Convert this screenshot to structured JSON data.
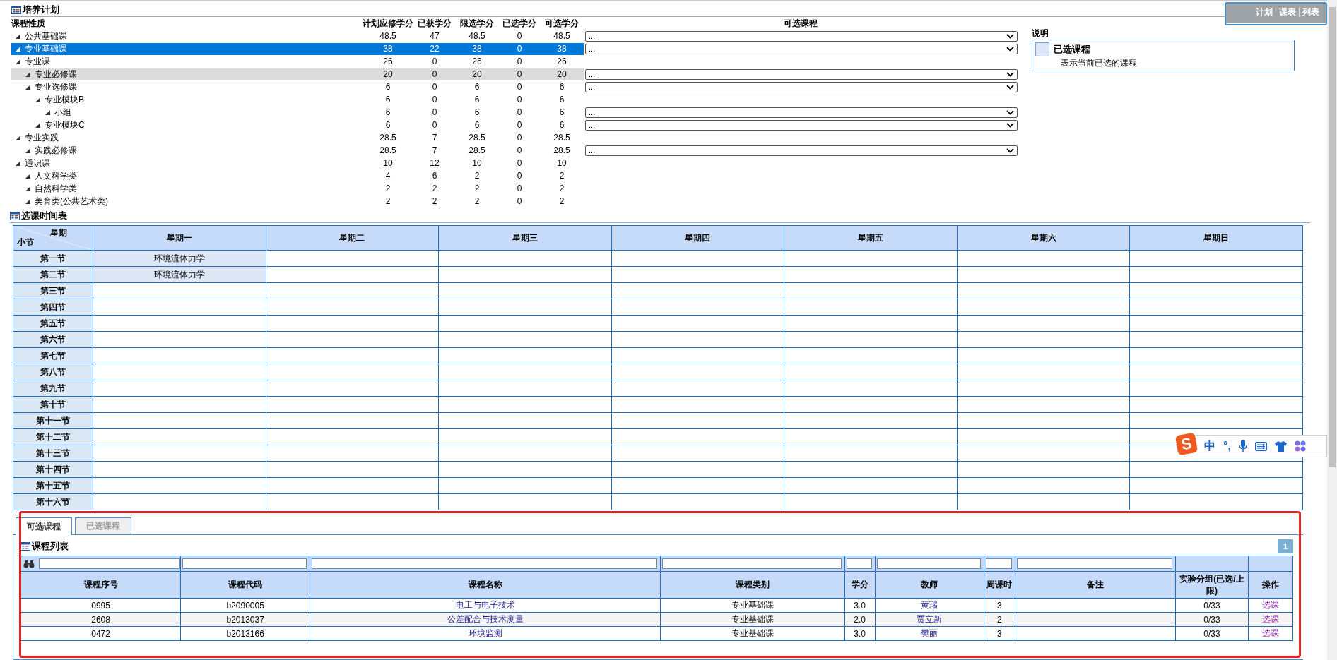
{
  "view_toggle": [
    "计划",
    "课表",
    "列表"
  ],
  "plan": {
    "title": "培养计划",
    "columns": [
      "课程性质",
      "计划应修学分",
      "已获学分",
      "限选学分",
      "已选学分",
      "可选学分",
      "可选课程"
    ],
    "rows": [
      {
        "name": "公共基础课",
        "values": [
          "48.5",
          "47",
          "48.5",
          "0",
          "48.5"
        ],
        "expanded": true,
        "selected": false,
        "hovered": false,
        "dropdown": "..."
      },
      {
        "name": "专业基础课",
        "values": [
          "38",
          "22",
          "38",
          "0",
          "38"
        ],
        "expanded": true,
        "selected": true,
        "hovered": false,
        "dropdown": "..."
      },
      {
        "name": "专业课",
        "values": [
          "26",
          "0",
          "26",
          "0",
          "26"
        ],
        "expanded": true,
        "selected": false,
        "hovered": false,
        "children": [
          {
            "name": "专业必修课",
            "values": [
              "20",
              "0",
              "20",
              "0",
              "20"
            ],
            "expanded": true,
            "selected": false,
            "hovered": true,
            "dropdown": "..."
          },
          {
            "name": "专业选修课",
            "values": [
              "6",
              "0",
              "6",
              "0",
              "6"
            ],
            "expanded": true,
            "selected": false,
            "hovered": false,
            "dropdown": "...",
            "children": [
              {
                "name": "专业模块B",
                "values": [
                  "6",
                  "0",
                  "6",
                  "0",
                  "6"
                ],
                "expanded": true,
                "selected": false,
                "hovered": false,
                "children": [
                  {
                    "name": "小组",
                    "values": [
                      "6",
                      "0",
                      "6",
                      "0",
                      "6"
                    ],
                    "expanded": true,
                    "selected": false,
                    "hovered": false,
                    "dropdown": "..."
                  }
                ]
              },
              {
                "name": "专业模块C",
                "values": [
                  "6",
                  "0",
                  "6",
                  "0",
                  "6"
                ],
                "expanded": true,
                "selected": false,
                "hovered": false,
                "dropdown": "..."
              }
            ]
          }
        ]
      },
      {
        "name": "专业实践",
        "values": [
          "28.5",
          "7",
          "28.5",
          "0",
          "28.5"
        ],
        "expanded": true,
        "selected": false,
        "hovered": false,
        "children": [
          {
            "name": "实践必修课",
            "values": [
              "28.5",
              "7",
              "28.5",
              "0",
              "28.5"
            ],
            "expanded": true,
            "selected": false,
            "hovered": false,
            "dropdown": "..."
          }
        ]
      },
      {
        "name": "通识课",
        "values": [
          "10",
          "12",
          "10",
          "0",
          "10"
        ],
        "expanded": true,
        "selected": false,
        "hovered": false,
        "children": [
          {
            "name": "人文科学类",
            "values": [
              "4",
              "6",
              "2",
              "0",
              "2"
            ],
            "expanded": true,
            "selected": false,
            "hovered": false
          },
          {
            "name": "自然科学类",
            "values": [
              "2",
              "2",
              "2",
              "0",
              "2"
            ],
            "expanded": true,
            "selected": false,
            "hovered": false
          },
          {
            "name": "美育类(公共艺术类)",
            "values": [
              "2",
              "2",
              "2",
              "0",
              "2"
            ],
            "expanded": true,
            "selected": false,
            "hovered": false
          }
        ]
      }
    ],
    "legend": {
      "title": "说明",
      "item": "已选课程",
      "description": "表示当前已选的课程"
    }
  },
  "timetable": {
    "title": "选课时间表",
    "corner_top": "星期",
    "corner_bottom": "小节",
    "days": [
      "星期一",
      "星期二",
      "星期三",
      "星期四",
      "星期五",
      "星期六",
      "星期日"
    ],
    "periods": [
      {
        "label": "第一节",
        "cells": [
          "环境流体力学",
          null,
          null,
          null,
          null,
          null,
          null
        ]
      },
      {
        "label": "第二节",
        "cells": [
          "环境流体力学",
          null,
          null,
          null,
          null,
          null,
          null
        ]
      },
      {
        "label": "第三节"
      },
      {
        "label": "第四节"
      },
      {
        "label": "第五节"
      },
      {
        "label": "第六节"
      },
      {
        "label": "第七节"
      },
      {
        "label": "第八节"
      },
      {
        "label": "第九节"
      },
      {
        "label": "第十节"
      },
      {
        "label": "第十一节"
      },
      {
        "label": "第十二节"
      },
      {
        "label": "第十三节"
      },
      {
        "label": "第十四节"
      },
      {
        "label": "第十五节"
      },
      {
        "label": "第十六节"
      }
    ]
  },
  "course_panel": {
    "tabs": [
      {
        "label": "可选课程",
        "selected": true
      },
      {
        "label": "已选课程",
        "selected": false
      }
    ],
    "title": "课程列表",
    "pager": "1",
    "columns": [
      {
        "label": "课程序号",
        "filter": true,
        "kind": "text"
      },
      {
        "label": "课程代码",
        "filter": true,
        "kind": "text"
      },
      {
        "label": "课程名称",
        "filter": true,
        "kind": "link"
      },
      {
        "label": "课程类别",
        "filter": true,
        "kind": "text"
      },
      {
        "label": "学分",
        "filter": true,
        "kind": "text"
      },
      {
        "label": "教师",
        "filter": true,
        "kind": "link"
      },
      {
        "label": "周课时",
        "filter": true,
        "kind": "text"
      },
      {
        "label": "备注",
        "filter": true,
        "kind": "text"
      },
      {
        "label": "实验分组(已选/上限)",
        "filter": false,
        "kind": "text"
      },
      {
        "label": "操作",
        "filter": false,
        "kind": "action"
      }
    ],
    "rows": [
      {
        "cells": [
          "0995",
          "b2090005",
          "电工与电子技术",
          "专业基础课",
          "3.0",
          "黄瑞",
          "3",
          null,
          "0/33",
          "选课"
        ]
      },
      {
        "cells": [
          "2608",
          "b2013037",
          "公差配合与技术测量",
          "专业基础课",
          "2.0",
          "贾立新",
          "2",
          null,
          "0/33",
          "选课"
        ]
      },
      {
        "cells": [
          "0472",
          "b2013166",
          "环境监测",
          "专业基础课",
          "3.0",
          "樊丽",
          "3",
          null,
          "0/33",
          "选课"
        ]
      }
    ]
  },
  "ime_toolbar": {
    "logo": "S",
    "mode": "中",
    "punctuation": "°,"
  }
}
